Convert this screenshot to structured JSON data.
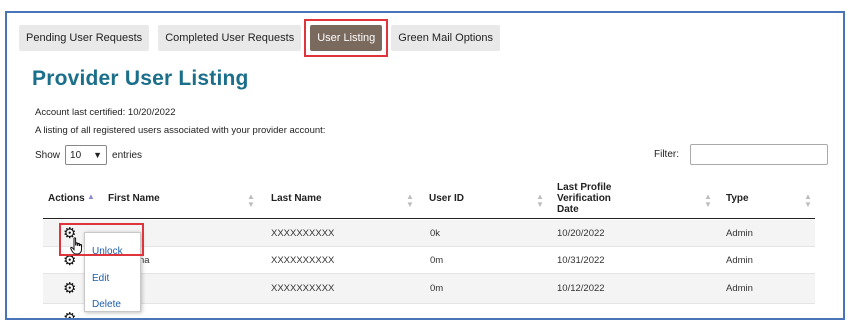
{
  "tabs": [
    {
      "label": "Pending User Requests"
    },
    {
      "label": "Completed User Requests"
    },
    {
      "label": "User Listing",
      "active": true
    },
    {
      "label": "Green Mail Options"
    }
  ],
  "page": {
    "title": "Provider User Listing",
    "certified": "Account last certified: 10/20/2022",
    "description": "A listing of all registered users associated with your provider account:"
  },
  "length_control": {
    "show_label": "Show",
    "value": "10",
    "entries_label": "entries"
  },
  "filter": {
    "label": "Filter:",
    "value": ""
  },
  "table": {
    "columns": [
      "Actions",
      "First Name",
      "Last Name",
      "User ID",
      "Last Profile Verification Date",
      "Type"
    ],
    "column_lines": [
      "Last Profile",
      "Verification",
      "Date"
    ],
    "rows": [
      {
        "first_name": "",
        "last_name": "XXXXXXXXXX",
        "user_id": "0k",
        "date": "10/20/2022",
        "type": "Admin"
      },
      {
        "first_name": "na",
        "last_name": "XXXXXXXXXX",
        "user_id": "0m",
        "date": "10/31/2022",
        "type": "Admin"
      },
      {
        "first_name": "",
        "last_name": "XXXXXXXXXX",
        "user_id": "0m",
        "date": "10/12/2022",
        "type": "Admin"
      }
    ]
  },
  "action_menu": {
    "items": [
      "Unlock",
      "Edit",
      "Delete"
    ]
  },
  "colors": {
    "title": "#1b6f8a",
    "active_tab": "#7a6a5e",
    "highlight": "#e0343d",
    "link": "#1d5fa8",
    "frame": "#4a74b8"
  },
  "icons": {
    "row_action": "gear-icon",
    "pointer": "hand-cursor-icon",
    "sort": "sort-arrows-icon",
    "dropdown": "chevron-down-icon"
  }
}
